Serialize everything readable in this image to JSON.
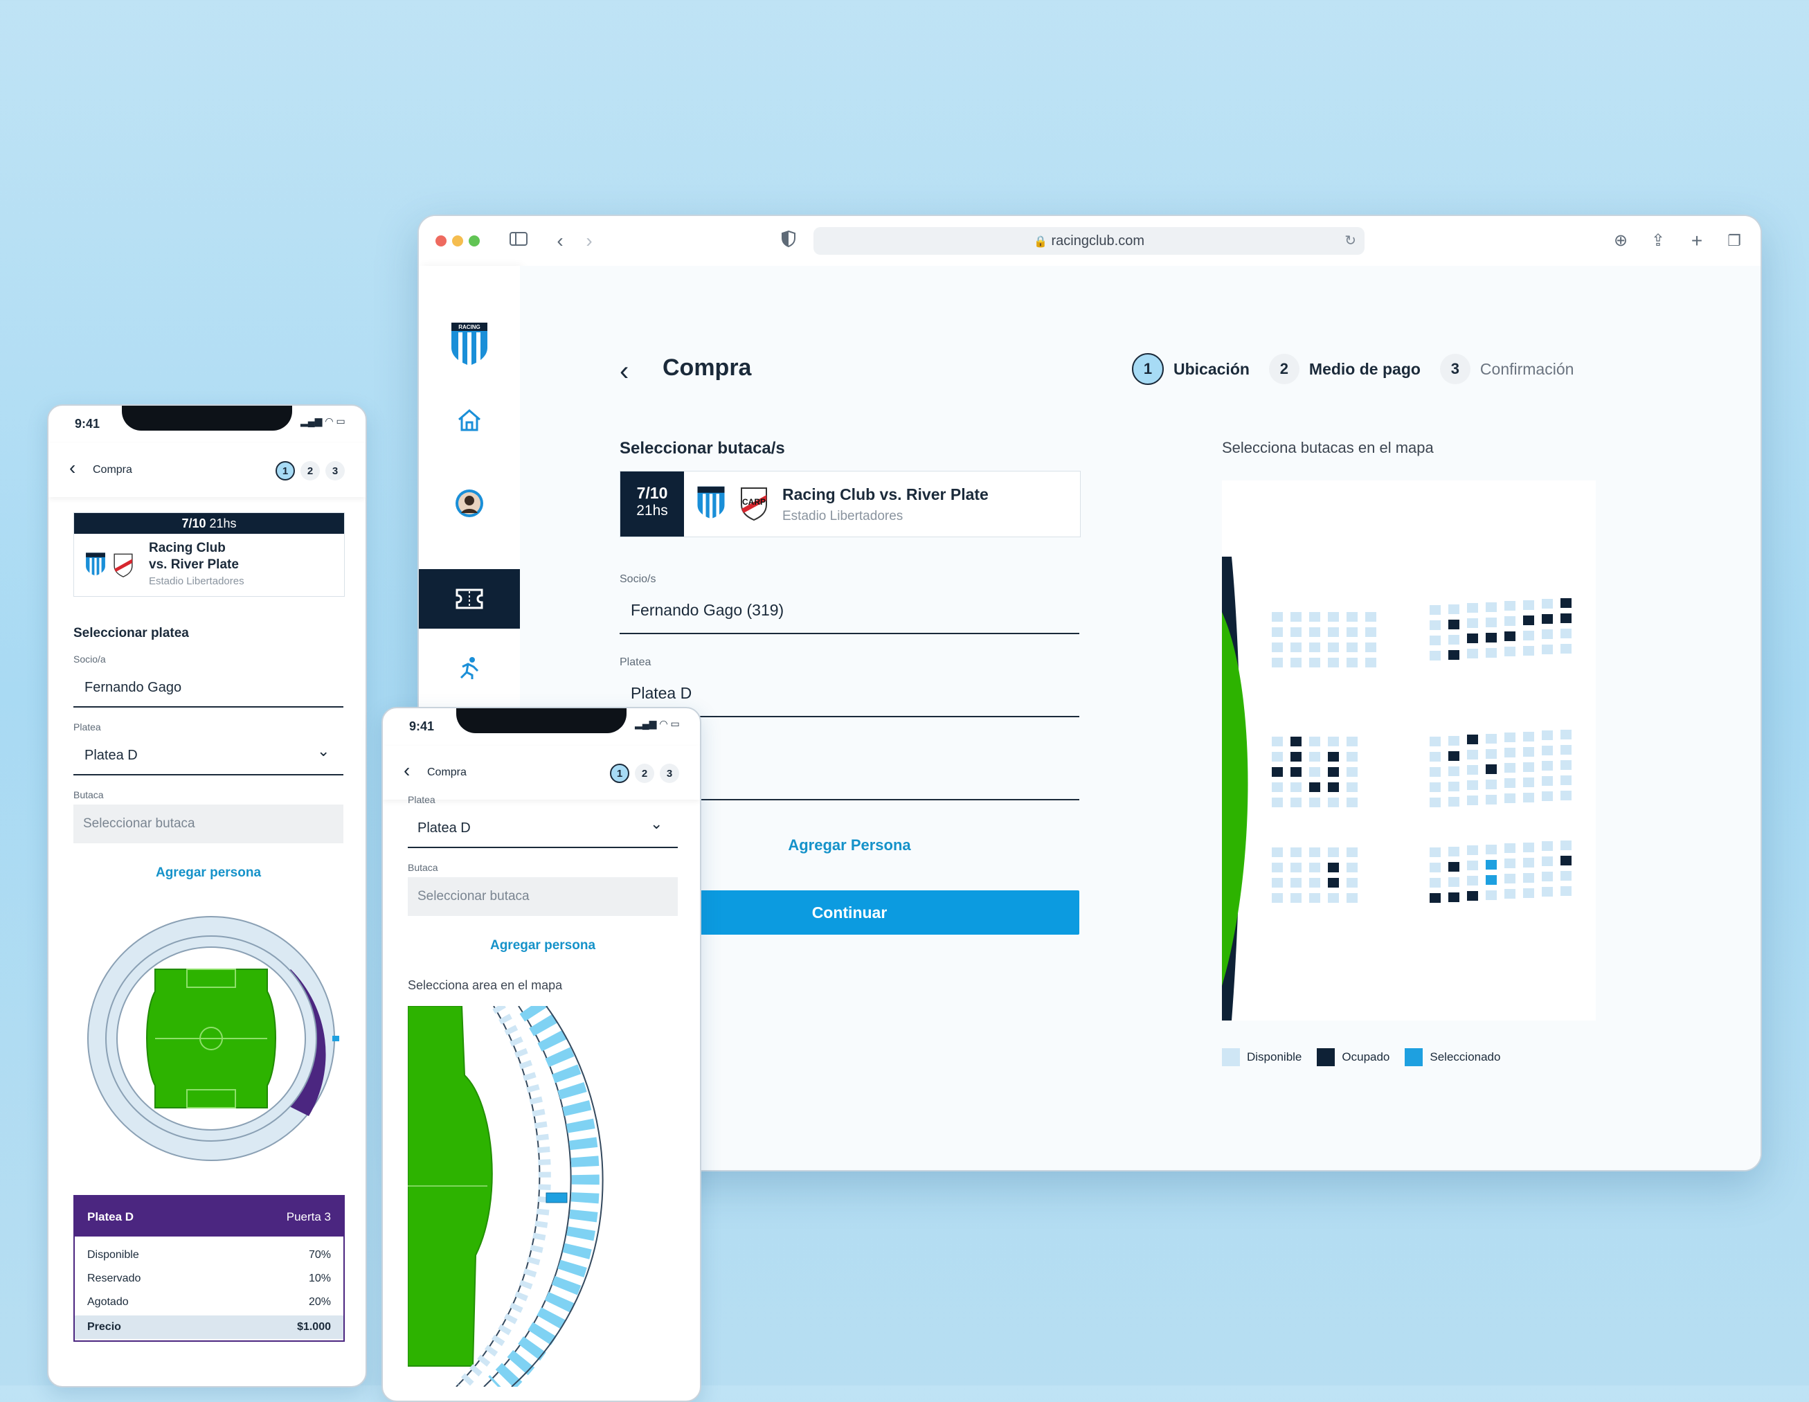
{
  "browser": {
    "url": "racingclub.com",
    "page_title": "Compra",
    "steps": [
      {
        "num": "1",
        "label": "Ubicación"
      },
      {
        "num": "2",
        "label": "Medio de pago"
      },
      {
        "num": "3",
        "label": "Confirmación"
      }
    ],
    "section_title": "Seleccionar butaca/s",
    "event": {
      "date": "7/10",
      "time": "21hs",
      "match": "Racing Club vs. River Plate",
      "venue": "Estadio Libertadores"
    },
    "socio_label": "Socio/s",
    "socio_value": "Fernando Gago (319)",
    "platea_label": "Platea",
    "platea_value": "Platea D",
    "add_person": "Agregar Persona",
    "continue": "Continuar",
    "map_title": "Selecciona butacas en el mapa",
    "legend": [
      {
        "label": "Disponible",
        "color": "#cfe6f5"
      },
      {
        "label": "Ocupado",
        "color": "#0e2136"
      },
      {
        "label": "Seleccionado",
        "color": "#1ea0e0"
      }
    ]
  },
  "phone1": {
    "time": "9:41",
    "nav_title": "Compra",
    "steps": [
      "1",
      "2",
      "3"
    ],
    "event": {
      "date": "7/10",
      "time": "21hs",
      "match_line1": "Racing Club",
      "match_line2": "vs. River Plate",
      "venue": "Estadio Libertadores"
    },
    "section_title": "Seleccionar platea",
    "socio_label": "Socio/a",
    "socio_value": "Fernando Gago",
    "platea_label": "Platea",
    "platea_value": "Platea D",
    "butaca_label": "Butaca",
    "butaca_placeholder": "Seleccionar butaca",
    "add_person": "Agregar persona",
    "info": {
      "title": "Platea D",
      "gate": "Puerta 3",
      "rows": [
        {
          "label": "Disponible",
          "value": "70%"
        },
        {
          "label": "Reservado",
          "value": "10%"
        },
        {
          "label": "Agotado",
          "value": "20%"
        }
      ],
      "price_label": "Precio",
      "price_value": "$1.000"
    }
  },
  "phone2": {
    "time": "9:41",
    "nav_title": "Compra",
    "steps": [
      "1",
      "2",
      "3"
    ],
    "platea_label": "Platea",
    "platea_value": "Platea D",
    "butaca_label": "Butaca",
    "butaca_placeholder": "Seleccionar butaca",
    "add_person": "Agregar persona",
    "map_title": "Selecciona area en el mapa"
  },
  "colors": {
    "accent": "#0c9be0",
    "navy": "#0e2136",
    "pitch": "#2db300",
    "purple": "#4b2680",
    "available": "#cfe6f5"
  }
}
